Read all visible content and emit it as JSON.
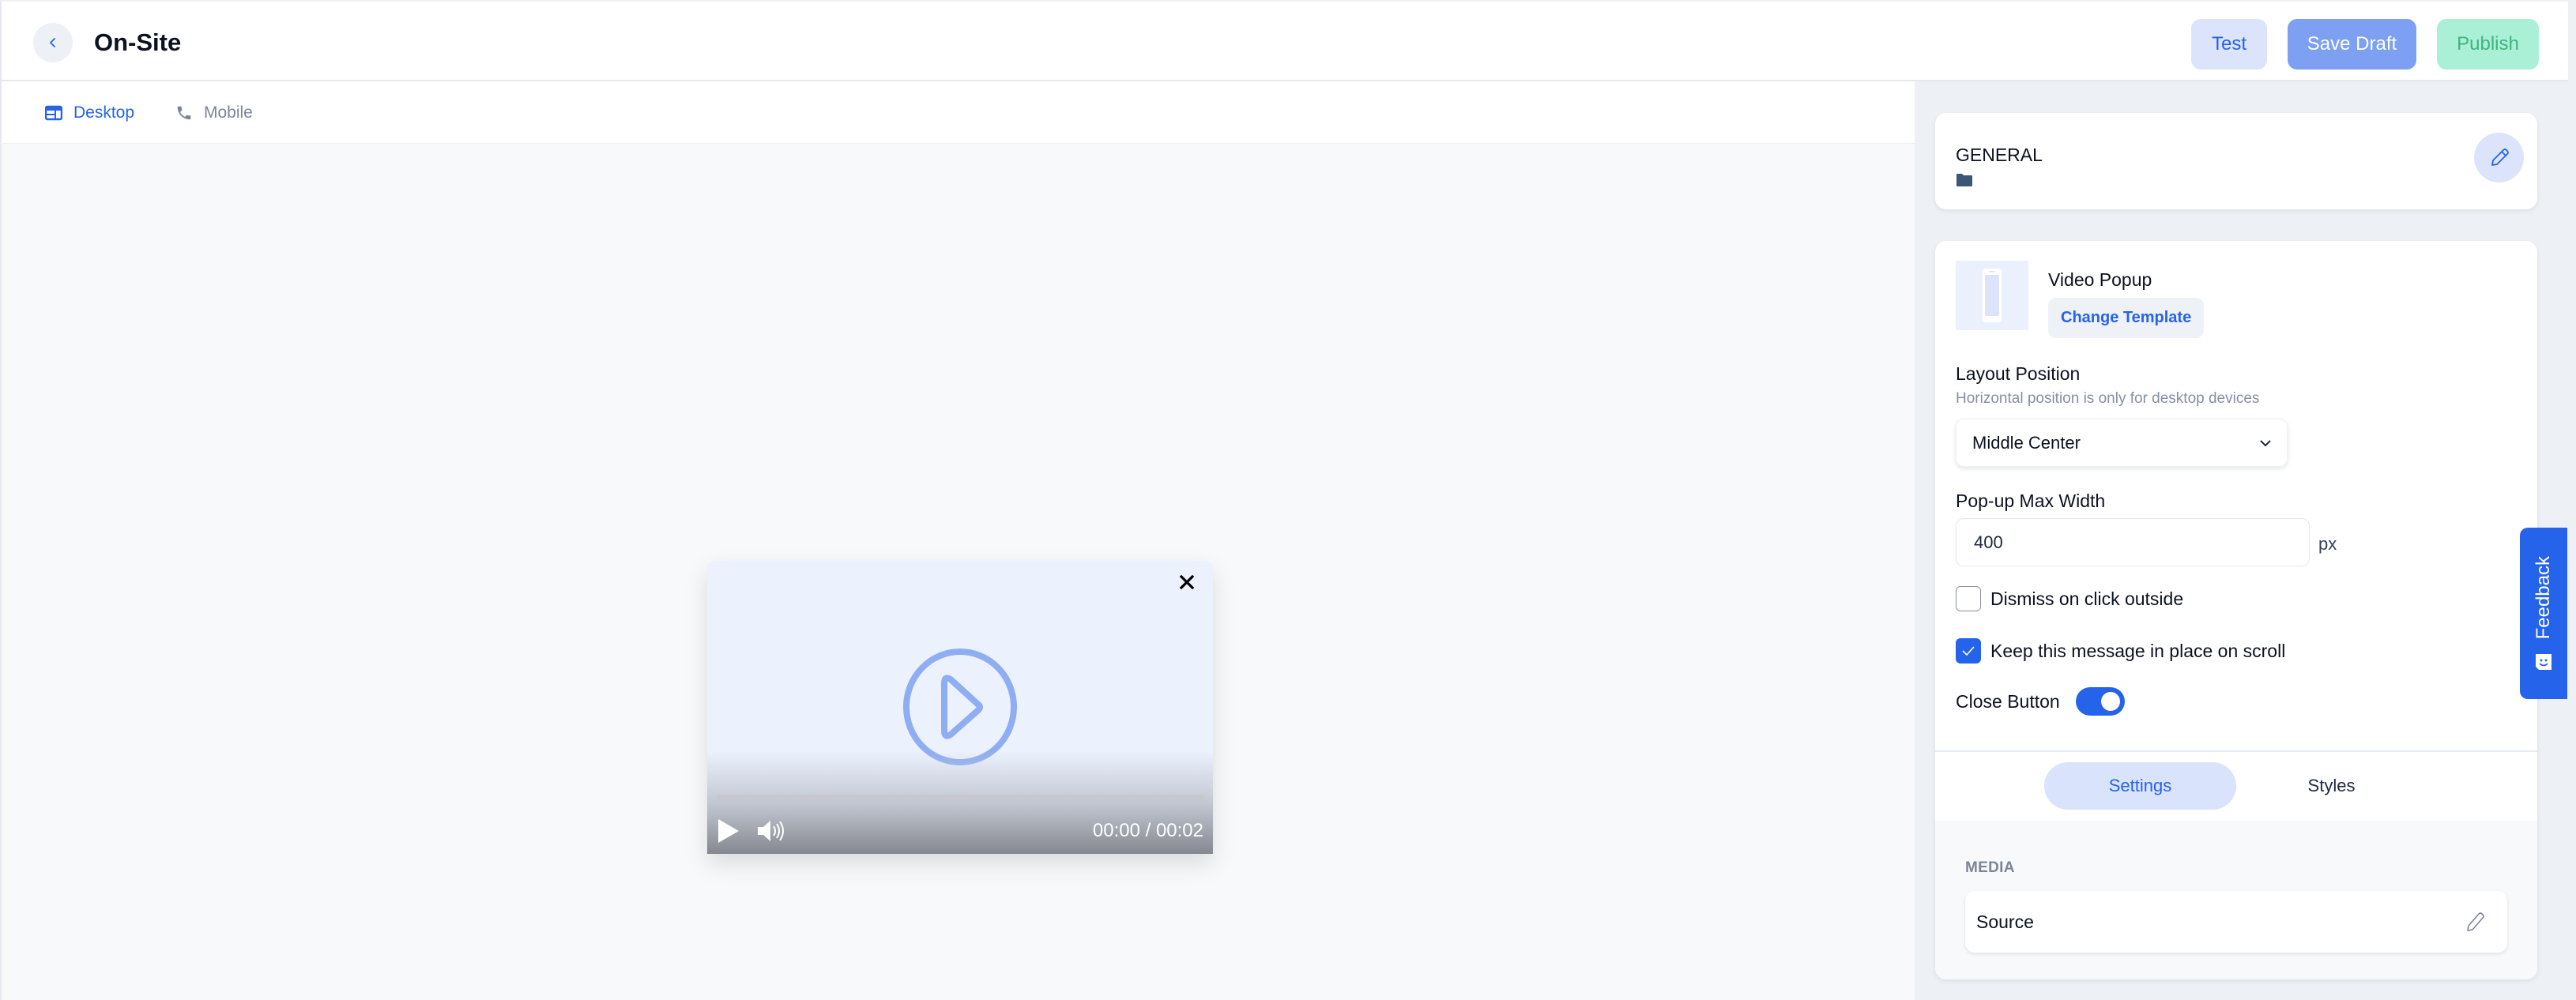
{
  "header": {
    "title": "On-Site",
    "buttons": {
      "test": "Test",
      "save_draft": "Save Draft",
      "publish": "Publish"
    }
  },
  "device_tabs": [
    {
      "label": "Desktop",
      "icon": "desktop-icon",
      "active": true
    },
    {
      "label": "Mobile",
      "icon": "phone-icon",
      "active": false
    }
  ],
  "preview": {
    "close_icon": "close-icon",
    "center_icon": "play-circle-icon",
    "player": {
      "current_time": "00:00",
      "duration": "00:02",
      "time_display": "00:00 / 00:02",
      "progress": 0
    }
  },
  "sidebar": {
    "general_card": {
      "title": "GENERAL",
      "folder_icon": "folder-icon",
      "edit_icon": "pencil-icon"
    },
    "template": {
      "name": "Video Popup",
      "change_label": "Change Template"
    },
    "layout_position": {
      "label": "Layout Position",
      "hint": "Horizontal position is only for desktop devices",
      "selected": "Middle Center"
    },
    "max_width": {
      "label": "Pop-up Max Width",
      "value": "400",
      "unit": "px"
    },
    "options": [
      {
        "label": "Dismiss on click outside",
        "checked": false
      },
      {
        "label": "Keep this message in place on scroll",
        "checked": true
      }
    ],
    "close_button": {
      "label": "Close Button",
      "enabled": true
    },
    "tabs": [
      {
        "label": "Settings",
        "active": true
      },
      {
        "label": "Styles",
        "active": false
      }
    ],
    "media": {
      "section_label": "MEDIA",
      "source_label": "Source"
    }
  },
  "feedback": {
    "label": "Feedback"
  },
  "colors": {
    "accent": "#2563eb",
    "accent_light": "#dbe4fb",
    "save_draft_bg": "#7da0f3",
    "publish_bg": "#aaf0d7",
    "publish_text": "#3fb47f",
    "canvas_bg": "#f8f9fb",
    "sidebar_bg": "#edf0f4"
  }
}
